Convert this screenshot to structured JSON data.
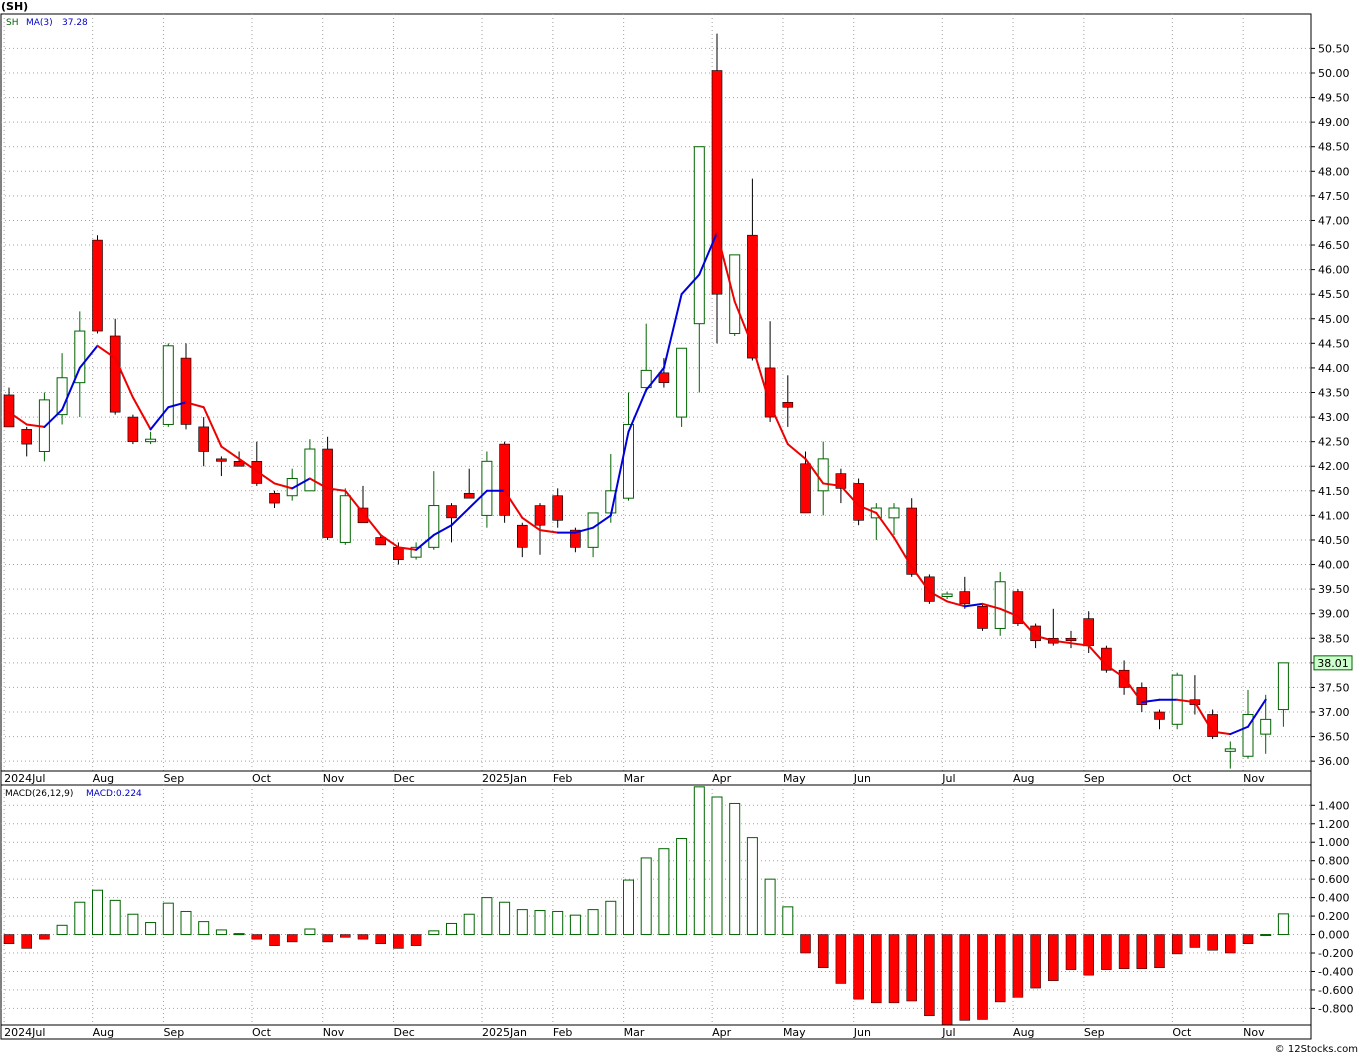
{
  "header": {
    "title": "(SH)",
    "legend_symbol": "SH",
    "legend_ma_label": "MA(3)",
    "legend_ma_value": "37.28",
    "macd_label": "MACD(26,12,9)",
    "macd_value_label": "MACD:0.224",
    "last_price": "38.01",
    "credit": "© 12Stocks.com"
  },
  "colors": {
    "up_candle": "#ffffff",
    "up_outline": "#006400",
    "down_candle": "#ff0000",
    "ma_up": "#0000dd",
    "ma_down": "#ee0000",
    "grid": "#a0a0a0",
    "axis_band": "#ffffff"
  },
  "chart_data": [
    {
      "type": "candlestick",
      "ylim": [
        35.8,
        51.2
      ],
      "yticks": [
        "36.00",
        "36.50",
        "37.00",
        "37.50",
        "38.00",
        "38.50",
        "39.00",
        "39.50",
        "40.00",
        "40.50",
        "41.00",
        "41.50",
        "42.00",
        "42.50",
        "43.00",
        "43.50",
        "44.00",
        "44.50",
        "45.00",
        "45.50",
        "46.00",
        "46.50",
        "47.00",
        "47.50",
        "48.00",
        "48.50",
        "49.00",
        "49.50",
        "50.00",
        "50.50"
      ],
      "xticks": [
        {
          "i": 0,
          "label": "2024Jul"
        },
        {
          "i": 5,
          "label": "Aug"
        },
        {
          "i": 9,
          "label": "Sep"
        },
        {
          "i": 14,
          "label": "Oct"
        },
        {
          "i": 18,
          "label": "Nov"
        },
        {
          "i": 22,
          "label": "Dec"
        },
        {
          "i": 27,
          "label": "2025Jan"
        },
        {
          "i": 31,
          "label": "Feb"
        },
        {
          "i": 35,
          "label": "Mar"
        },
        {
          "i": 40,
          "label": "Apr"
        },
        {
          "i": 44,
          "label": "May"
        },
        {
          "i": 48,
          "label": "Jun"
        },
        {
          "i": 53,
          "label": "Jul"
        },
        {
          "i": 57,
          "label": "Aug"
        },
        {
          "i": 61,
          "label": "Sep"
        },
        {
          "i": 66,
          "label": "Oct"
        },
        {
          "i": 70,
          "label": "Nov"
        }
      ],
      "candles": [
        {
          "o": 43.45,
          "h": 43.6,
          "l": 42.8,
          "c": 42.8
        },
        {
          "o": 42.75,
          "h": 42.8,
          "l": 42.2,
          "c": 42.45
        },
        {
          "o": 42.3,
          "h": 43.5,
          "l": 42.1,
          "c": 43.35
        },
        {
          "o": 43.05,
          "h": 44.3,
          "l": 42.85,
          "c": 43.8
        },
        {
          "o": 43.7,
          "h": 45.15,
          "l": 43.0,
          "c": 44.75
        },
        {
          "o": 46.6,
          "h": 46.7,
          "l": 44.7,
          "c": 44.75
        },
        {
          "o": 44.65,
          "h": 45.0,
          "l": 43.05,
          "c": 43.1
        },
        {
          "o": 43.0,
          "h": 43.05,
          "l": 42.45,
          "c": 42.5
        },
        {
          "o": 42.5,
          "h": 42.7,
          "l": 42.45,
          "c": 42.55
        },
        {
          "o": 42.85,
          "h": 44.5,
          "l": 42.8,
          "c": 44.45
        },
        {
          "o": 44.2,
          "h": 44.5,
          "l": 42.75,
          "c": 42.85
        },
        {
          "o": 42.8,
          "h": 43.0,
          "l": 42.0,
          "c": 42.3
        },
        {
          "o": 42.15,
          "h": 42.2,
          "l": 41.8,
          "c": 42.1
        },
        {
          "o": 42.1,
          "h": 42.3,
          "l": 42.0,
          "c": 42.0
        },
        {
          "o": 42.1,
          "h": 42.5,
          "l": 41.6,
          "c": 41.65
        },
        {
          "o": 41.45,
          "h": 41.5,
          "l": 41.15,
          "c": 41.25
        },
        {
          "o": 41.4,
          "h": 41.95,
          "l": 41.3,
          "c": 41.75
        },
        {
          "o": 41.5,
          "h": 42.55,
          "l": 41.5,
          "c": 42.35
        },
        {
          "o": 42.35,
          "h": 42.6,
          "l": 40.5,
          "c": 40.55
        },
        {
          "o": 40.45,
          "h": 41.55,
          "l": 40.4,
          "c": 41.4
        },
        {
          "o": 41.15,
          "h": 41.6,
          "l": 40.85,
          "c": 40.85
        },
        {
          "o": 40.55,
          "h": 40.6,
          "l": 40.4,
          "c": 40.4
        },
        {
          "o": 40.35,
          "h": 40.45,
          "l": 40.0,
          "c": 40.1
        },
        {
          "o": 40.15,
          "h": 40.45,
          "l": 40.1,
          "c": 40.35
        },
        {
          "o": 40.35,
          "h": 41.9,
          "l": 40.3,
          "c": 41.2
        },
        {
          "o": 41.2,
          "h": 41.25,
          "l": 40.45,
          "c": 40.95
        },
        {
          "o": 41.45,
          "h": 41.95,
          "l": 41.35,
          "c": 41.35
        },
        {
          "o": 41.0,
          "h": 42.3,
          "l": 40.75,
          "c": 42.1
        },
        {
          "o": 42.45,
          "h": 42.5,
          "l": 40.85,
          "c": 41.0
        },
        {
          "o": 40.8,
          "h": 40.85,
          "l": 40.15,
          "c": 40.35
        },
        {
          "o": 41.2,
          "h": 41.25,
          "l": 40.2,
          "c": 40.8
        },
        {
          "o": 41.4,
          "h": 41.55,
          "l": 40.75,
          "c": 40.9
        },
        {
          "o": 40.7,
          "h": 40.75,
          "l": 40.25,
          "c": 40.35
        },
        {
          "o": 40.35,
          "h": 41.0,
          "l": 40.15,
          "c": 41.05
        },
        {
          "o": 41.05,
          "h": 42.25,
          "l": 40.85,
          "c": 41.5
        },
        {
          "o": 41.35,
          "h": 43.5,
          "l": 41.3,
          "c": 42.85
        },
        {
          "o": 43.6,
          "h": 44.9,
          "l": 43.5,
          "c": 43.95
        },
        {
          "o": 43.9,
          "h": 44.2,
          "l": 43.6,
          "c": 43.7
        },
        {
          "o": 43.0,
          "h": 44.4,
          "l": 42.8,
          "c": 44.4
        },
        {
          "o": 44.9,
          "h": 48.5,
          "l": 43.5,
          "c": 48.5
        },
        {
          "o": 50.05,
          "h": 50.8,
          "l": 44.5,
          "c": 45.5
        },
        {
          "o": 44.7,
          "h": 46.3,
          "l": 44.65,
          "c": 46.3
        },
        {
          "o": 46.7,
          "h": 47.85,
          "l": 44.15,
          "c": 44.2
        },
        {
          "o": 44.0,
          "h": 44.95,
          "l": 42.9,
          "c": 43.0
        },
        {
          "o": 43.3,
          "h": 43.85,
          "l": 42.8,
          "c": 43.2
        },
        {
          "o": 42.05,
          "h": 42.3,
          "l": 41.05,
          "c": 41.05
        },
        {
          "o": 41.5,
          "h": 42.5,
          "l": 41.0,
          "c": 42.15
        },
        {
          "o": 41.85,
          "h": 41.95,
          "l": 41.25,
          "c": 41.55
        },
        {
          "o": 41.65,
          "h": 41.75,
          "l": 40.8,
          "c": 40.9
        },
        {
          "o": 40.95,
          "h": 41.25,
          "l": 40.5,
          "c": 41.15
        },
        {
          "o": 40.95,
          "h": 41.25,
          "l": 40.6,
          "c": 41.15
        },
        {
          "o": 41.15,
          "h": 41.35,
          "l": 39.75,
          "c": 39.8
        },
        {
          "o": 39.75,
          "h": 39.8,
          "l": 39.2,
          "c": 39.25
        },
        {
          "o": 39.35,
          "h": 39.45,
          "l": 39.3,
          "c": 39.4
        },
        {
          "o": 39.45,
          "h": 39.75,
          "l": 39.1,
          "c": 39.2
        },
        {
          "o": 39.15,
          "h": 39.2,
          "l": 38.65,
          "c": 38.7
        },
        {
          "o": 38.7,
          "h": 39.85,
          "l": 38.55,
          "c": 39.65
        },
        {
          "o": 39.45,
          "h": 39.5,
          "l": 38.75,
          "c": 38.8
        },
        {
          "o": 38.75,
          "h": 38.8,
          "l": 38.3,
          "c": 38.45
        },
        {
          "o": 38.5,
          "h": 39.1,
          "l": 38.35,
          "c": 38.4
        },
        {
          "o": 38.5,
          "h": 38.65,
          "l": 38.3,
          "c": 38.45
        },
        {
          "o": 38.9,
          "h": 39.05,
          "l": 38.2,
          "c": 38.35
        },
        {
          "o": 38.3,
          "h": 38.35,
          "l": 37.8,
          "c": 37.85
        },
        {
          "o": 37.85,
          "h": 38.05,
          "l": 37.35,
          "c": 37.5
        },
        {
          "o": 37.5,
          "h": 37.6,
          "l": 37.0,
          "c": 37.15
        },
        {
          "o": 37.0,
          "h": 37.05,
          "l": 36.65,
          "c": 36.85
        },
        {
          "o": 36.75,
          "h": 37.8,
          "l": 36.65,
          "c": 37.75
        },
        {
          "o": 37.25,
          "h": 37.75,
          "l": 36.95,
          "c": 37.15
        },
        {
          "o": 36.95,
          "h": 37.05,
          "l": 36.45,
          "c": 36.5
        },
        {
          "o": 36.2,
          "h": 36.4,
          "l": 35.85,
          "c": 36.25
        },
        {
          "o": 36.1,
          "h": 37.45,
          "l": 36.05,
          "c": 36.95
        },
        {
          "o": 36.55,
          "h": 37.35,
          "l": 36.15,
          "c": 36.85
        },
        {
          "o": 37.05,
          "h": 38.0,
          "l": 36.7,
          "c": 38.0
        }
      ],
      "ma3": [
        43.1,
        42.85,
        42.8,
        43.15,
        44.0,
        44.45,
        44.2,
        43.4,
        42.75,
        43.2,
        43.3,
        43.2,
        42.4,
        42.15,
        41.9,
        41.65,
        41.55,
        41.75,
        41.55,
        41.5,
        41.05,
        40.6,
        40.35,
        40.3,
        40.6,
        40.8,
        41.15,
        41.5,
        41.5,
        40.95,
        40.7,
        40.65,
        40.65,
        40.75,
        41.0,
        42.7,
        43.55,
        44.0,
        45.5,
        45.9,
        46.75,
        45.35,
        44.45,
        43.25,
        42.45,
        42.15,
        41.65,
        41.6,
        41.2,
        41.05,
        40.55,
        39.95,
        39.45,
        39.25,
        39.15,
        39.2,
        39.1,
        38.95,
        38.55,
        38.45,
        38.4,
        38.35,
        37.95,
        37.7,
        37.2,
        37.25,
        37.25,
        37.2,
        36.6,
        36.55,
        36.7,
        37.25
      ]
    },
    {
      "type": "bar",
      "name": "MACD(26,12,9)",
      "ylim": [
        -0.98,
        1.62
      ],
      "yticks": [
        "-0.800",
        "-0.600",
        "-0.400",
        "-0.200",
        "0.000",
        "0.200",
        "0.400",
        "0.600",
        "0.800",
        "1.000",
        "1.200",
        "1.400"
      ],
      "values": [
        -0.1,
        -0.15,
        -0.05,
        0.1,
        0.35,
        0.48,
        0.37,
        0.22,
        0.13,
        0.34,
        0.25,
        0.14,
        0.05,
        0.01,
        -0.05,
        -0.12,
        -0.08,
        0.06,
        -0.08,
        -0.03,
        -0.05,
        -0.1,
        -0.15,
        -0.12,
        0.04,
        0.12,
        0.22,
        0.4,
        0.35,
        0.27,
        0.26,
        0.25,
        0.21,
        0.27,
        0.36,
        0.59,
        0.83,
        0.93,
        1.04,
        1.6,
        1.49,
        1.42,
        1.05,
        0.6,
        0.3,
        -0.2,
        -0.36,
        -0.53,
        -0.7,
        -0.74,
        -0.74,
        -0.72,
        -0.88,
        -0.98,
        -0.93,
        -0.92,
        -0.73,
        -0.68,
        -0.58,
        -0.5,
        -0.38,
        -0.44,
        -0.38,
        -0.37,
        -0.37,
        -0.36,
        -0.21,
        -0.14,
        -0.17,
        -0.2,
        -0.1,
        0.0,
        0.224
      ]
    }
  ]
}
